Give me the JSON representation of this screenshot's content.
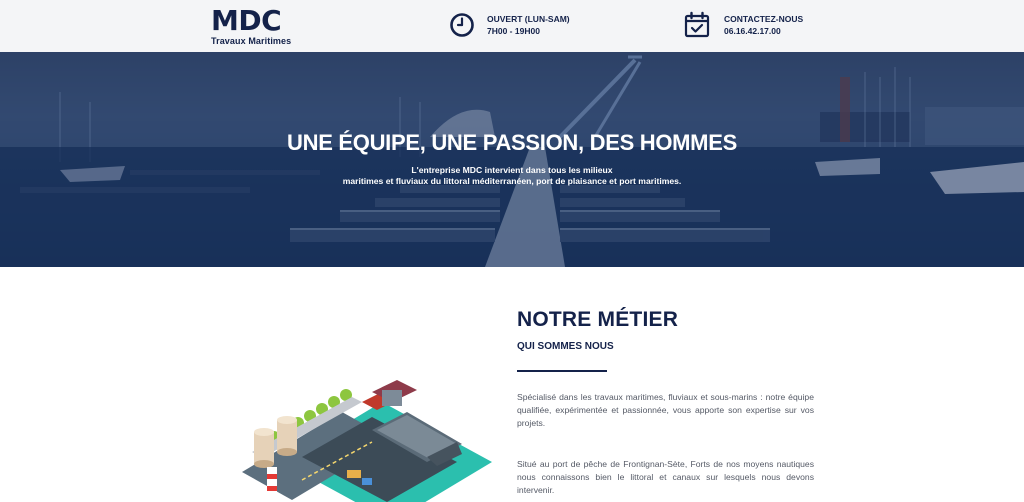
{
  "header": {
    "logo_main": "MDC",
    "logo_sub": "Travaux Maritimes",
    "hours_label": "OUVERT (LUN-SAM)",
    "hours_value": "7H00 - 19H00",
    "contact_label": "CONTACTEZ-NOUS",
    "contact_value": "06.16.42.17.00",
    "clock_icon": "clock-icon",
    "calendar_icon": "calendar-check-icon"
  },
  "hero": {
    "title": "UNE ÉQUIPE, UNE PASSION, DES HOMMES",
    "line1": "L'entreprise MDC intervient dans tous les milieux",
    "line2": "maritimes et fluviaux du littoral méditerranéen, port de plaisance et port maritimes."
  },
  "section": {
    "title": "NOTRE MÉTIER",
    "subtitle": "QUI SOMMES NOUS",
    "paragraph1": "Spécialisé dans les travaux maritimes, fluviaux et sous-marins : notre équipe qualifiée, expérimentée et passionnée, vous apporte son expertise sur vos projets.",
    "paragraph2": "Situé au port de pêche de Frontignan-Sète, Forts de nos moyens nautiques nous connaissons bien le littoral et canaux sur lesquels nous devons intervenir."
  },
  "colors": {
    "brand_navy": "#14224a",
    "header_bg": "#f4f5f7",
    "text_grey": "#555a66"
  }
}
